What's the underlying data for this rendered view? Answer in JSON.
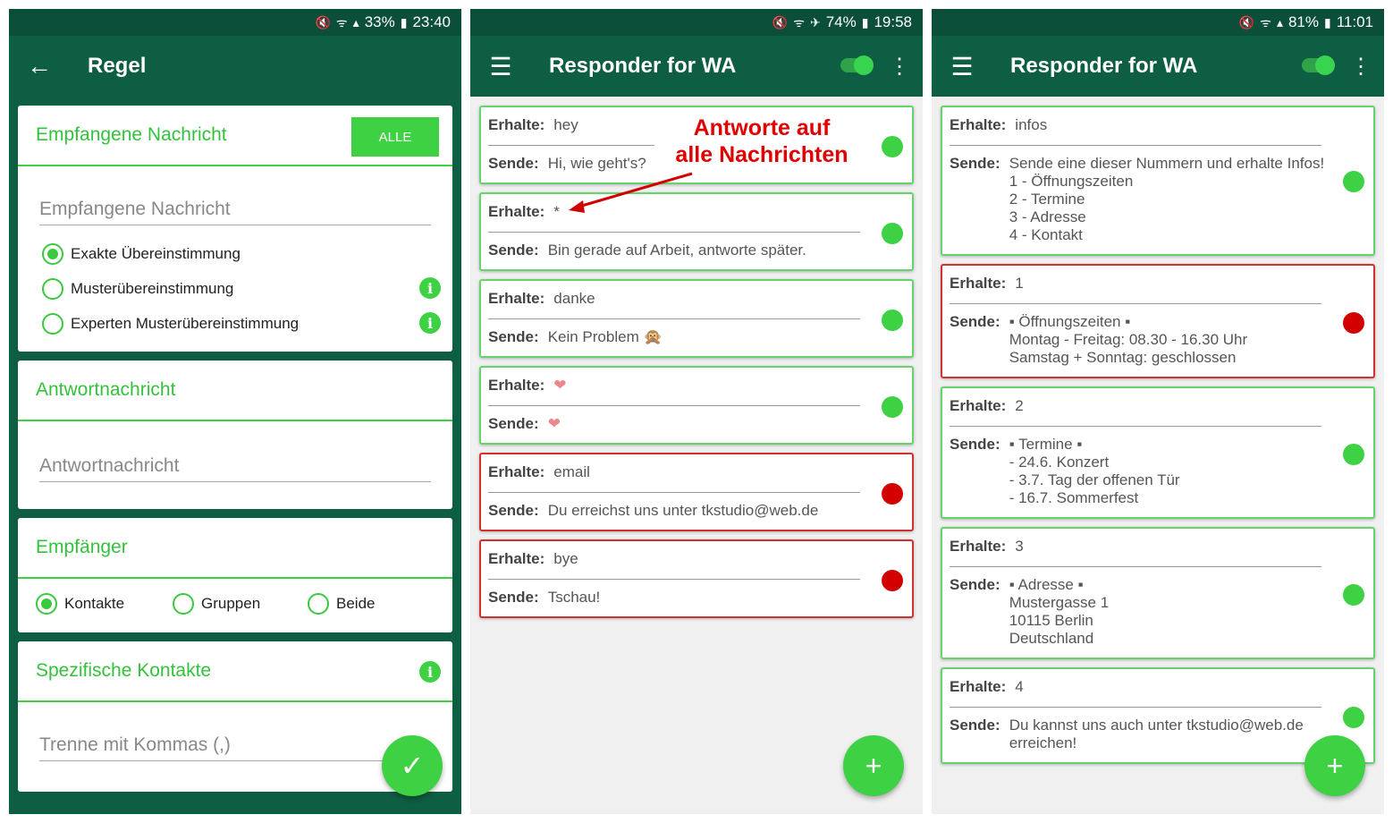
{
  "left": {
    "status": {
      "battery": "33%",
      "time": "23:40"
    },
    "title": "Regel",
    "received_section": {
      "title": "Empfangene Nachricht",
      "alle": "ALLE",
      "placeholder": "Empfangene Nachricht",
      "options": [
        "Exakte Übereinstimmung",
        "Musterübereinstimmung",
        "Experten Musterübereinstimmung"
      ]
    },
    "reply_section": {
      "title": "Antwortnachricht",
      "placeholder": "Antwortnachricht"
    },
    "recipient_section": {
      "title": "Empfänger",
      "options": [
        "Kontakte",
        "Gruppen",
        "Beide"
      ]
    },
    "contacts_section": {
      "title": "Spezifische Kontakte",
      "placeholder": "Trenne mit Kommas (,)"
    }
  },
  "middle": {
    "status": {
      "battery": "74%",
      "time": "19:58"
    },
    "title": "Responder for WA",
    "annotation": {
      "line1": "Antworte auf",
      "line2": "alle Nachrichten"
    },
    "labels": {
      "receive": "Erhalte:",
      "send": "Sende:"
    },
    "rules": [
      {
        "receive": "hey",
        "send": "Hi, wie geht's?",
        "active": true
      },
      {
        "receive": "*",
        "send": "Bin gerade auf Arbeit, antworte später.",
        "active": true
      },
      {
        "receive": "danke",
        "send": "Kein Problem 🙊",
        "active": true
      },
      {
        "receive": "❤",
        "send": "❤",
        "active": true
      },
      {
        "receive": "email",
        "send": "Du erreichst uns unter tkstudio@web.de",
        "active": false
      },
      {
        "receive": "bye",
        "send": "Tschau!",
        "active": false
      }
    ]
  },
  "right": {
    "status": {
      "battery": "81%",
      "time": "11:01"
    },
    "title": "Responder for WA",
    "labels": {
      "receive": "Erhalte:",
      "send": "Sende:"
    },
    "rules": [
      {
        "receive": "infos",
        "send": [
          "Sende eine dieser Nummern und erhalte Infos!",
          "1 - Öffnungszeiten",
          "2 - Termine",
          "3 - Adresse",
          "4 - Kontakt"
        ],
        "active": true
      },
      {
        "receive": "1",
        "send": [
          "▪ Öffnungszeiten ▪",
          "Montag - Freitag: 08.30 - 16.30 Uhr",
          "Samstag + Sonntag: geschlossen"
        ],
        "active": false
      },
      {
        "receive": "2",
        "send": [
          "▪ Termine ▪",
          "- 24.6. Konzert",
          "- 3.7. Tag der offenen Tür",
          "- 16.7. Sommerfest"
        ],
        "active": true
      },
      {
        "receive": "3",
        "send": [
          "▪ Adresse ▪",
          "Mustergasse 1",
          "10115 Berlin",
          "Deutschland"
        ],
        "active": true
      },
      {
        "receive": "4",
        "send": [
          "Du kannst uns auch unter tkstudio@web.de",
          "erreichen!"
        ],
        "active": true
      }
    ]
  }
}
